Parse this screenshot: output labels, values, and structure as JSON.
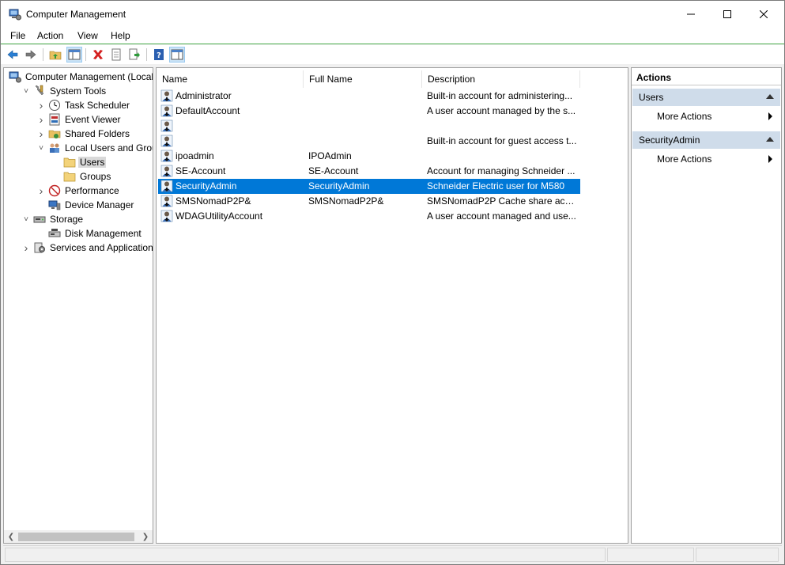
{
  "window": {
    "title": "Computer Management"
  },
  "menu": [
    "File",
    "Action",
    "View",
    "Help"
  ],
  "tree": [
    {
      "label": "Computer Management (Local",
      "depth": 0,
      "expander": "",
      "icon": "computer-management-icon"
    },
    {
      "label": "System Tools",
      "depth": 1,
      "expander": "down",
      "icon": "tools-icon"
    },
    {
      "label": "Task Scheduler",
      "depth": 2,
      "expander": "right",
      "icon": "clock-icon"
    },
    {
      "label": "Event Viewer",
      "depth": 2,
      "expander": "right",
      "icon": "event-viewer-icon"
    },
    {
      "label": "Shared Folders",
      "depth": 2,
      "expander": "right",
      "icon": "shared-folder-icon"
    },
    {
      "label": "Local Users and Groups",
      "depth": 2,
      "expander": "down",
      "icon": "users-group-icon"
    },
    {
      "label": "Users",
      "depth": 3,
      "expander": "",
      "icon": "folder-icon",
      "selected": true
    },
    {
      "label": "Groups",
      "depth": 3,
      "expander": "",
      "icon": "folder-icon"
    },
    {
      "label": "Performance",
      "depth": 2,
      "expander": "right",
      "icon": "performance-icon"
    },
    {
      "label": "Device Manager",
      "depth": 2,
      "expander": "",
      "icon": "device-manager-icon"
    },
    {
      "label": "Storage",
      "depth": 1,
      "expander": "down",
      "icon": "storage-icon"
    },
    {
      "label": "Disk Management",
      "depth": 2,
      "expander": "",
      "icon": "disk-icon"
    },
    {
      "label": "Services and Applications",
      "depth": 1,
      "expander": "right",
      "icon": "services-icon"
    }
  ],
  "list": {
    "columns": [
      "Name",
      "Full Name",
      "Description"
    ],
    "rows": [
      {
        "name": "Administrator",
        "full_name": "",
        "description": "Built-in account for administering..."
      },
      {
        "name": "DefaultAccount",
        "full_name": "",
        "description": "A user account managed by the s..."
      },
      {
        "name": "",
        "full_name": "",
        "description": ""
      },
      {
        "name": "",
        "full_name": "",
        "description": "Built-in account for guest access t..."
      },
      {
        "name": "ipoadmin",
        "full_name": "IPOAdmin",
        "description": ""
      },
      {
        "name": "SE-Account",
        "full_name": "SE-Account",
        "description": "Account for managing Schneider ..."
      },
      {
        "name": "SecurityAdmin",
        "full_name": "SecurityAdmin",
        "description": "Schneider Electric user for M580",
        "selected": true
      },
      {
        "name": "SMSNomadP2P&",
        "full_name": "SMSNomadP2P&",
        "description": "SMSNomadP2P Cache share acco..."
      },
      {
        "name": "WDAGUtilityAccount",
        "full_name": "",
        "description": "A user account managed and use..."
      }
    ]
  },
  "actions": {
    "title": "Actions",
    "sections": [
      {
        "label": "Users",
        "items": [
          "More Actions"
        ]
      },
      {
        "label": "SecurityAdmin",
        "items": [
          "More Actions"
        ]
      }
    ]
  },
  "colors": {
    "selection": "#0078d7",
    "section_header": "#cfdcea",
    "tree_selection": "#d9d9d9"
  }
}
